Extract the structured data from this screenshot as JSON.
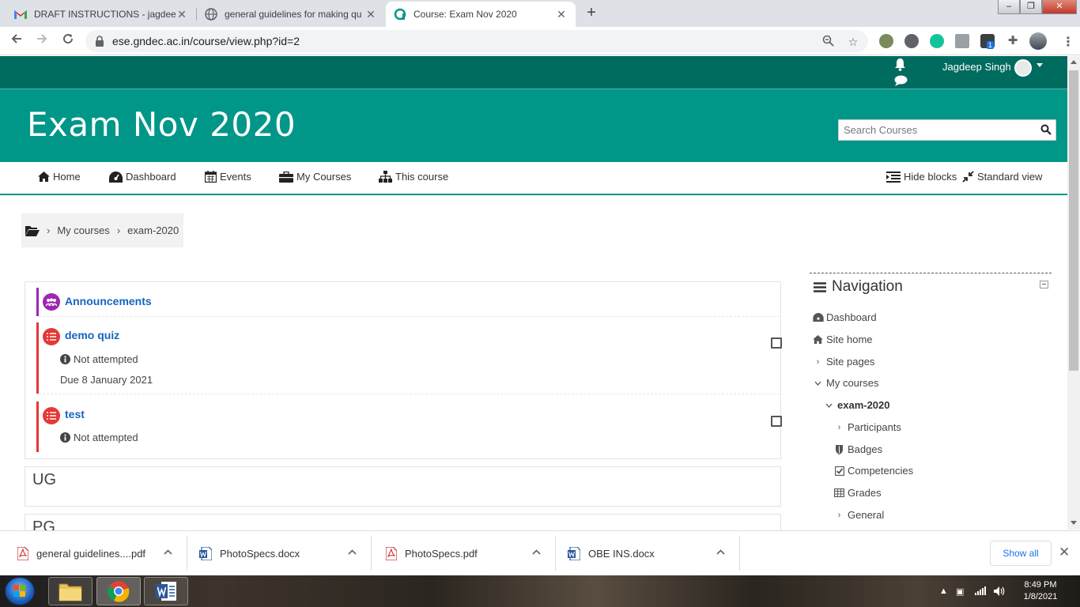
{
  "browser": {
    "tabs": [
      {
        "title": "DRAFT INSTRUCTIONS - jagdeep",
        "favicon": "gmail-icon",
        "active": false
      },
      {
        "title": "general guidelines for making qu",
        "favicon": "globe-icon",
        "active": false
      },
      {
        "title": "Course: Exam Nov 2020",
        "favicon": "moodle-icon",
        "active": true
      }
    ],
    "url": "ese.gndec.ac.in/course/view.php?id=2",
    "extension_badge": "1"
  },
  "topbar": {
    "user_name": "Jagdeep Singh"
  },
  "header": {
    "course_title": "Exam Nov 2020",
    "search_placeholder": "Search Courses"
  },
  "nav": {
    "items": [
      {
        "label": "Home",
        "icon": "home-icon"
      },
      {
        "label": "Dashboard",
        "icon": "dashboard-icon"
      },
      {
        "label": "Events",
        "icon": "calendar-icon"
      },
      {
        "label": "My Courses",
        "icon": "briefcase-icon"
      },
      {
        "label": "This course",
        "icon": "sitemap-icon"
      }
    ],
    "hide_blocks": "Hide blocks",
    "standard_view": "Standard view"
  },
  "breadcrumb": {
    "items": [
      "My courses",
      "exam-2020"
    ]
  },
  "activities": [
    {
      "name": "Announcements",
      "type": "forum"
    },
    {
      "name": "demo quiz",
      "type": "quiz",
      "status": "Not attempted",
      "due": "Due 8 January 2021"
    },
    {
      "name": "test",
      "type": "quiz",
      "status": "Not attempted"
    }
  ],
  "sections": [
    "UG",
    "PG"
  ],
  "navigation_block": {
    "title": "Navigation",
    "items": [
      {
        "label": "Dashboard",
        "icon": "dashboard-icon"
      },
      {
        "label": "Site home",
        "icon": "home-icon"
      },
      {
        "label": "Site pages",
        "icon": "chevron-right-icon"
      },
      {
        "label": "My courses",
        "icon": "chevron-down-icon"
      },
      {
        "label": "exam-2020",
        "icon": "chevron-down-icon"
      },
      {
        "label": "Participants",
        "icon": "chevron-right-icon"
      },
      {
        "label": "Badges",
        "icon": "shield-icon"
      },
      {
        "label": "Competencies",
        "icon": "check-square-icon"
      },
      {
        "label": "Grades",
        "icon": "table-icon"
      },
      {
        "label": "General",
        "icon": "chevron-right-icon"
      }
    ]
  },
  "downloads": {
    "items": [
      {
        "name": "general guidelines....pdf",
        "type": "pdf"
      },
      {
        "name": "PhotoSpecs.docx",
        "type": "docx"
      },
      {
        "name": "PhotoSpecs.pdf",
        "type": "pdf"
      },
      {
        "name": "OBE INS.docx",
        "type": "docx"
      }
    ],
    "show_all": "Show all"
  },
  "taskbar": {
    "time": "8:49 PM",
    "date": "1/8/2021"
  },
  "colors": {
    "topbar": "#006b5f",
    "header": "#009688",
    "link": "#1565c0",
    "quiz": "#e53935",
    "forum": "#9c27b0"
  }
}
